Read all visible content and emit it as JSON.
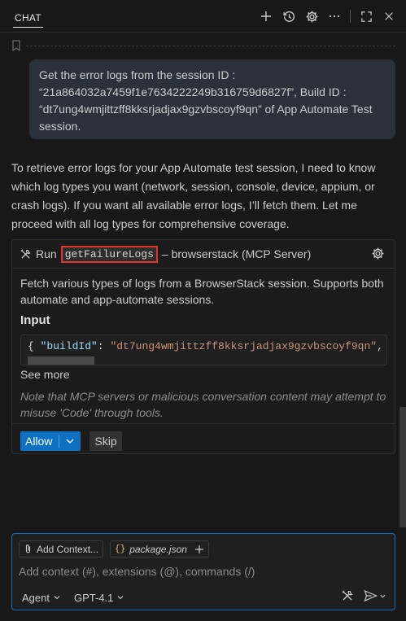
{
  "header": {
    "tab_label": "CHAT",
    "icons": [
      "plus-icon",
      "history-icon",
      "gear-icon",
      "more-icon",
      "maximize-icon",
      "close-icon"
    ]
  },
  "user_message": {
    "text": "Get the error logs from the session ID : “21a864032a7459f1e7634222249b316759d6827f”, Build ID : “dt7ung4wmjittzff8kksrjadjax9gzvbscoyf9qn” of App Automate Test session."
  },
  "assistant_response": {
    "text": "To retrieve error logs for your App Automate test session, I need to know which log types you want (network, session, console, device, appium, or crash logs). If you want all available error logs, I’ll fetch them. Let me proceed with all log types for comprehensive coverage."
  },
  "tool_call": {
    "run_label": "Run",
    "tool_name": "getFailureLogs",
    "server_label": "– browserstack (MCP Server)",
    "description": "Fetch various types of logs from a BrowserStack session. Supports both automate and app-automate sessions.",
    "input_label": "Input",
    "code": {
      "open": "{ ",
      "key": "\"buildId\"",
      "colon": ": ",
      "value": "\"dt7ung4wmjittzff8kksrjadjax9gzvbscoyf9qn\"",
      "tail": ", \""
    },
    "see_more": "See more",
    "note": "Note that MCP servers or malicious conversation content may attempt to misuse 'Code' through tools.",
    "allow_label": "Allow",
    "skip_label": "Skip"
  },
  "chat_input": {
    "add_context_label": "Add Context...",
    "file_chip": "package.json",
    "placeholder": "Add context (#), extensions (@), commands (/)",
    "mode": "Agent",
    "model": "GPT-4.1"
  },
  "colors": {
    "accent": "#0e70c0",
    "highlight_box": "#e2332c",
    "bubble": "#2a313b"
  }
}
